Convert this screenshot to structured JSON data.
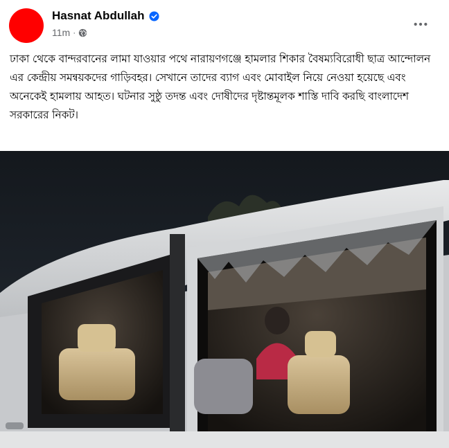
{
  "post": {
    "author": "Hasnat Abdullah",
    "timestamp": "11m",
    "separator": "·",
    "verified_icon": "verified-badge-icon",
    "privacy_icon": "globe-icon",
    "more_icon": "more-options-icon",
    "text": "ঢাকা থেকে বান্দরবানের লামা যাওয়ার পথে নারায়ণগঞ্জে হামলার শিকার বৈষম্যবিরোধী ছাত্র আন্দোলন এর কেন্দ্রীয় সমন্বয়কদের গাড়িবহর। সেখানে তাদের ব্যাগ এবং মোবাইল নিয়ে নেওয়া হয়েছে এবং অনেকেই হামলায় আহত। ঘটনার সুষ্ঠু তদন্ত এবং দোষীদের দৃষ্টান্তমূলক শাস্তি দাবি করছি বাংলাদেশ সরকারের নিকট।",
    "photo": {
      "subject": "white minivan with shattered side windows at night"
    }
  },
  "colors": {
    "avatar": "#ff0000",
    "verified": "#0866ff",
    "meta_text": "#65676b",
    "text": "#050505"
  }
}
